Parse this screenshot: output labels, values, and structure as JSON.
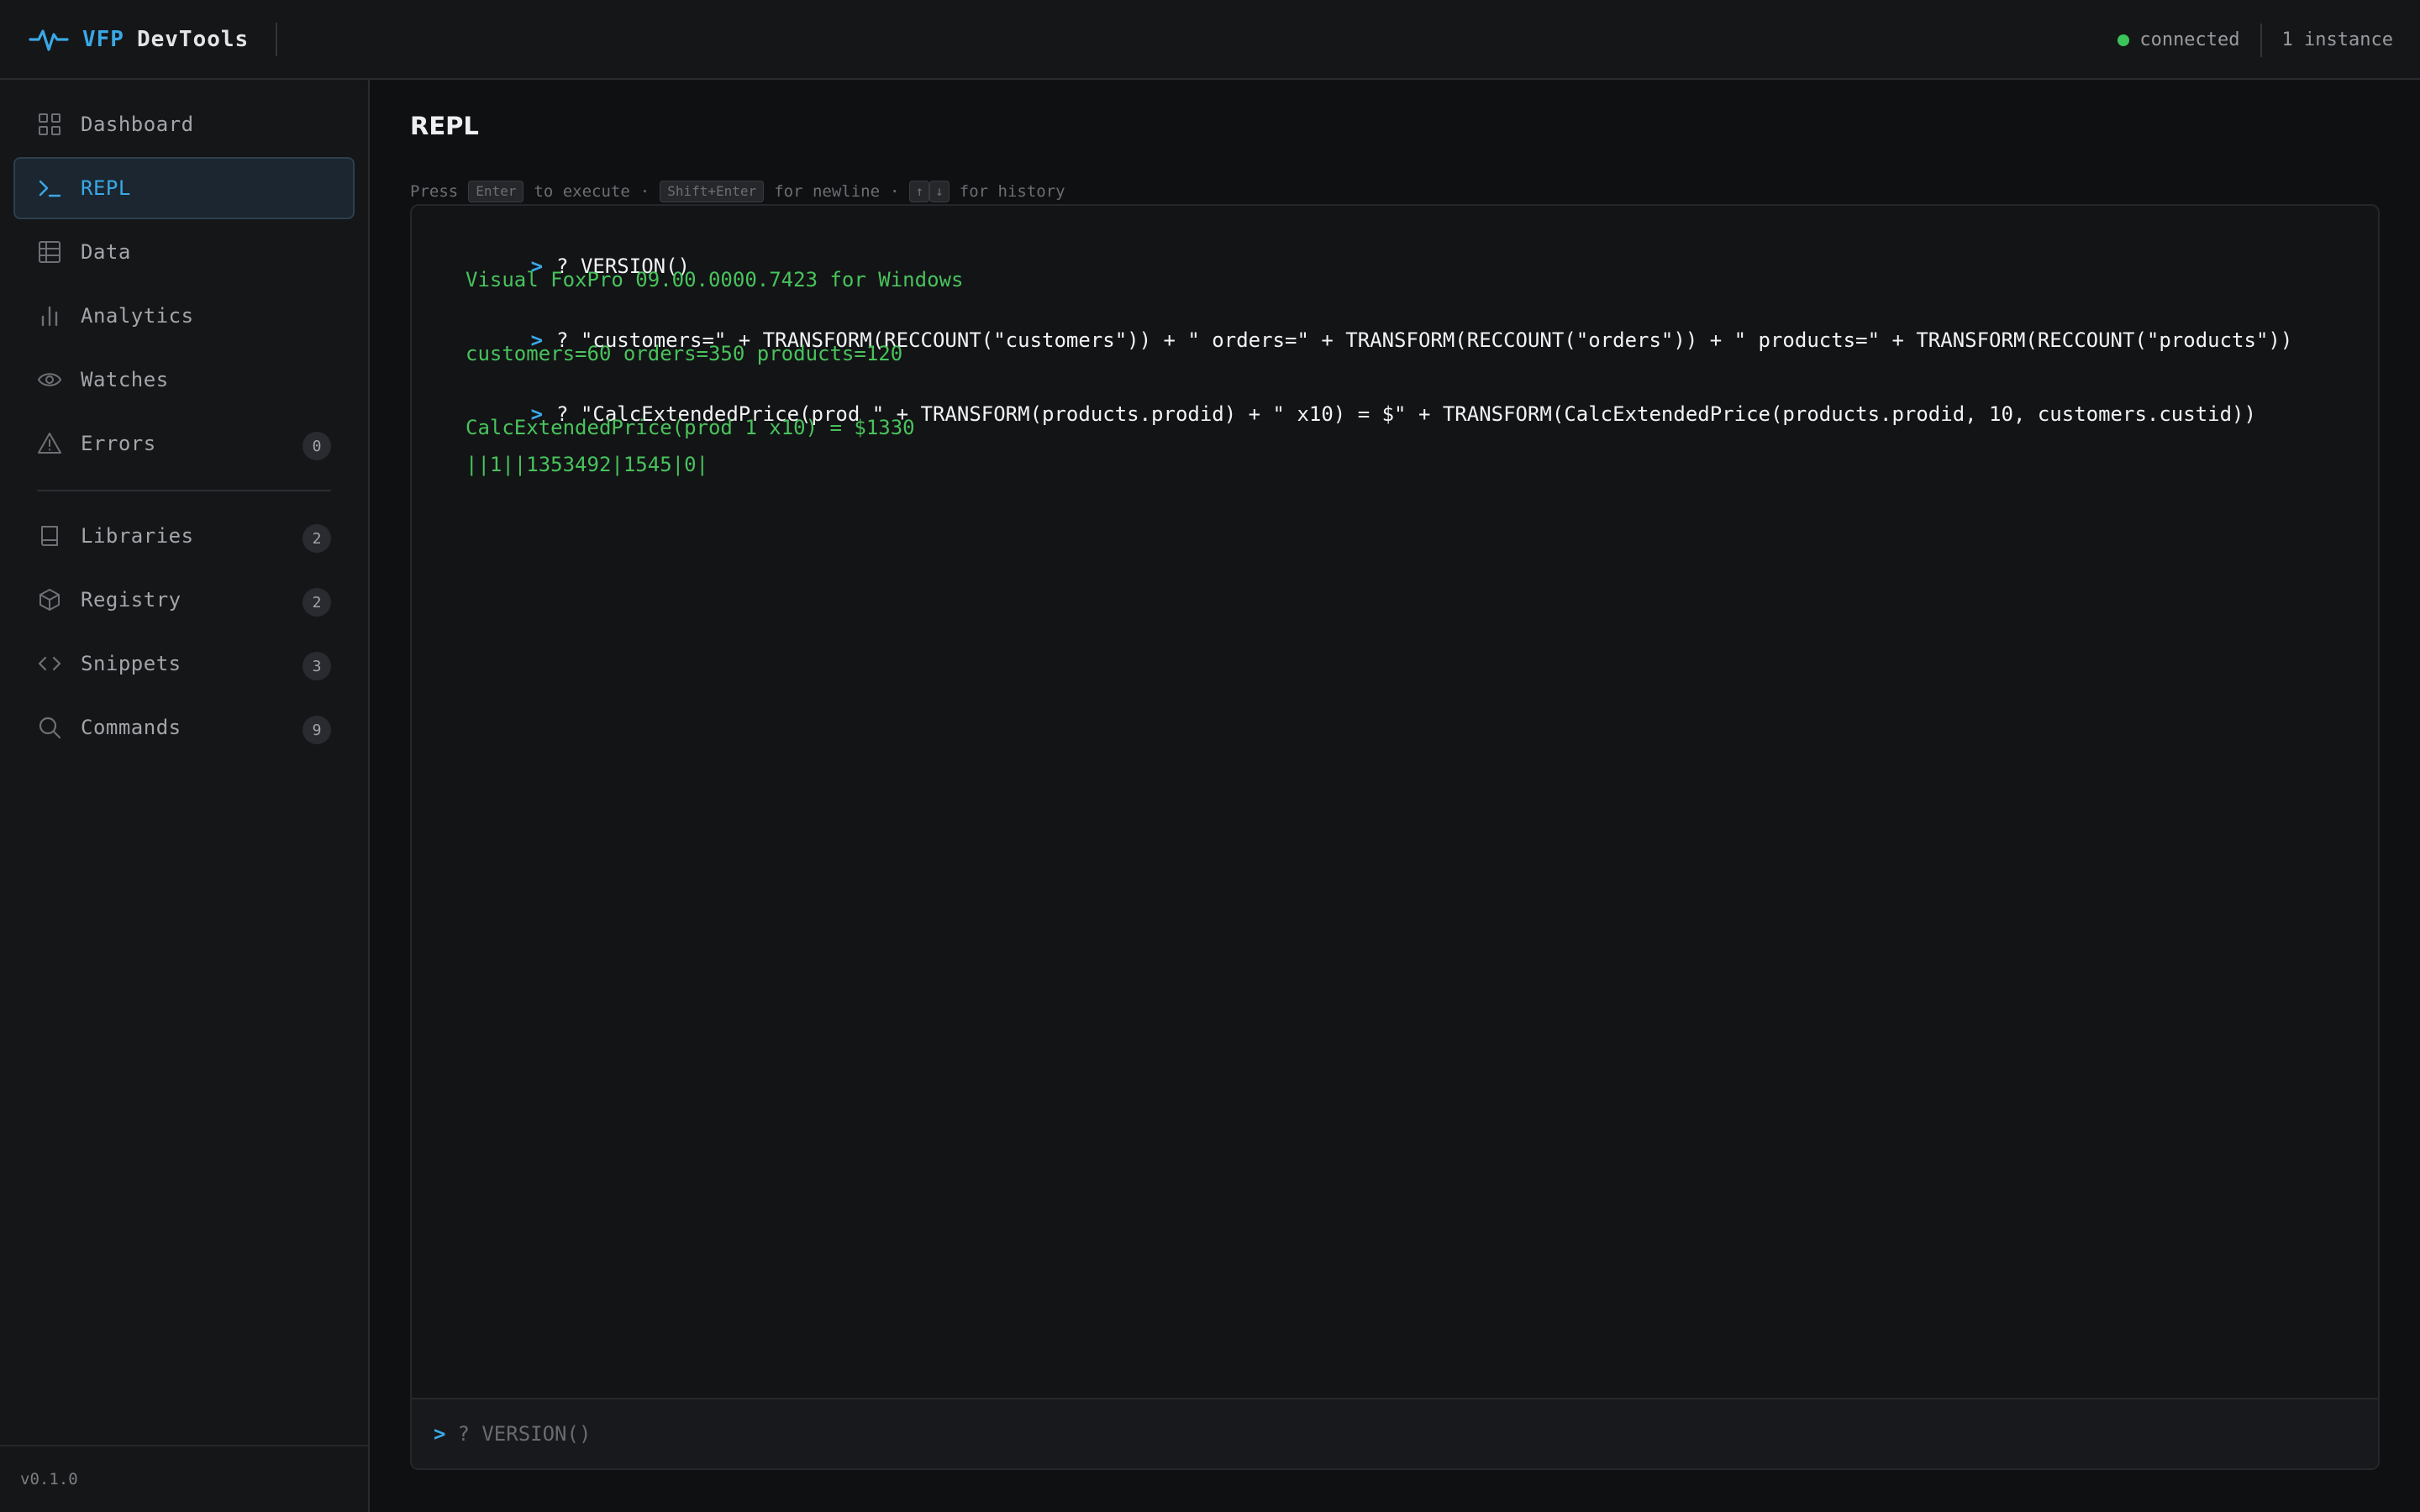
{
  "header": {
    "logo_accent": "VFP",
    "logo_rest": "DevTools",
    "status": "connected",
    "instances": "1 instance",
    "status_color": "#3cc35a",
    "accent_color": "#3aa8e6"
  },
  "sidebar": {
    "items": [
      {
        "label": "Dashboard",
        "icon": "grid-icon"
      },
      {
        "label": "REPL",
        "icon": "terminal-icon",
        "active": true
      },
      {
        "label": "Data",
        "icon": "table-icon"
      },
      {
        "label": "Analytics",
        "icon": "bar-chart-icon"
      },
      {
        "label": "Watches",
        "icon": "eye-icon"
      },
      {
        "label": "Errors",
        "icon": "warning-icon",
        "badge": "0"
      },
      {
        "label": "Libraries",
        "icon": "book-icon",
        "badge": "2"
      },
      {
        "label": "Registry",
        "icon": "cube-icon",
        "badge": "2"
      },
      {
        "label": "Snippets",
        "icon": "code-icon",
        "badge": "3"
      },
      {
        "label": "Commands",
        "icon": "search-icon",
        "badge": "9"
      }
    ],
    "version": "v0.1.0"
  },
  "main": {
    "title": "REPL",
    "hint": {
      "press": "Press",
      "enter_key": "Enter",
      "to_execute": "to execute",
      "sep1": "·",
      "shift_enter_key": "Shift+Enter",
      "for_newline": "for newline",
      "sep2": "·",
      "up_key": "↑",
      "down_key": "↓",
      "for_history": "for history"
    },
    "console": {
      "prompt_symbol": ">",
      "lines": [
        {
          "type": "command",
          "text": "? VERSION()"
        },
        {
          "type": "result",
          "text": "Visual FoxPro 09.00.0000.7423 for Windows"
        },
        {
          "type": "command",
          "text": "? \"customers=\" + TRANSFORM(RECCOUNT(\"customers\")) + \" orders=\" + TRANSFORM(RECCOUNT(\"orders\")) + \" products=\" + TRANSFORM(RECCOUNT(\"products\"))"
        },
        {
          "type": "result",
          "text": "customers=60 orders=350 products=120"
        },
        {
          "type": "command",
          "text": "? \"CalcExtendedPrice(prod \" + TRANSFORM(products.prodid) + \" x10) = $\" + TRANSFORM(CalcExtendedPrice(products.prodid, 10, customers.custid))"
        },
        {
          "type": "result",
          "text": "CalcExtendedPrice(prod 1 x10) = $1330"
        },
        {
          "type": "result",
          "text": "||1||1353492|1545|0|"
        }
      ],
      "input_placeholder": "? VERSION()",
      "input_value": ""
    }
  }
}
